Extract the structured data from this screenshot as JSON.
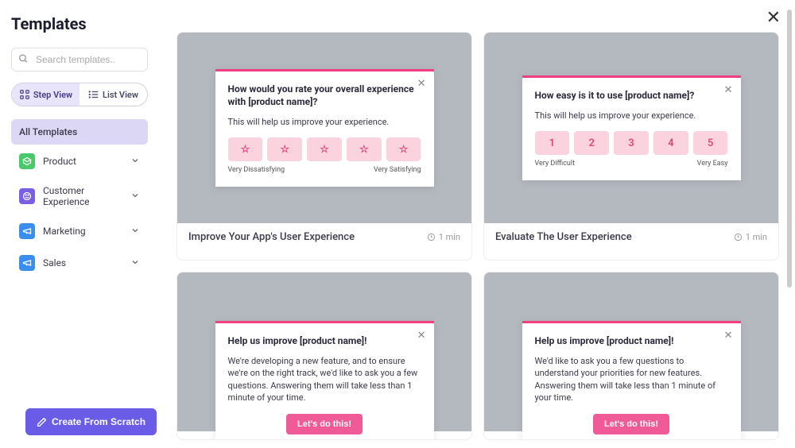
{
  "header": {
    "title": "Templates"
  },
  "search": {
    "placeholder": "Search templates.."
  },
  "view": {
    "step": "Step View",
    "list": "List View"
  },
  "categories": {
    "all": "All Templates",
    "items": [
      {
        "label": "Product",
        "color": "green"
      },
      {
        "label": "Customer Experience",
        "color": "purple"
      },
      {
        "label": "Marketing",
        "color": "blue"
      },
      {
        "label": "Sales",
        "color": "blue"
      }
    ]
  },
  "create": "Create From Scratch",
  "cards": [
    {
      "title": "Improve Your App's User Experience",
      "time": "1 min",
      "preview": {
        "type": "stars",
        "heading": "How would you rate your overall experience with [product name]?",
        "sub": "This will help us improve your experience.",
        "low": "Very Dissatisfying",
        "high": "Very Satisfying"
      }
    },
    {
      "title": "Evaluate The User Experience",
      "time": "1 min",
      "preview": {
        "type": "numbers",
        "heading": "How easy is it to use [product name]?",
        "sub": "This will help us improve your experience.",
        "options": [
          "1",
          "2",
          "3",
          "4",
          "5"
        ],
        "low": "Very Difficult",
        "high": "Very Easy"
      }
    },
    {
      "title": "",
      "time": "",
      "preview": {
        "type": "cta",
        "heading": "Help us improve [product name]!",
        "sub": "We're developing a new feature, and to ensure we're on the right track, we'd like to ask you a few questions. Answering them will take less than 1 minute of your time.",
        "cta": "Let's do this!"
      }
    },
    {
      "title": "",
      "time": "",
      "preview": {
        "type": "cta",
        "heading": "Help us improve [product name]!",
        "sub": "We'd like to ask you a few questions to understand your priorities for new features. Answering them will take less than 1 minute of your time.",
        "cta": "Let's do this!"
      }
    }
  ]
}
